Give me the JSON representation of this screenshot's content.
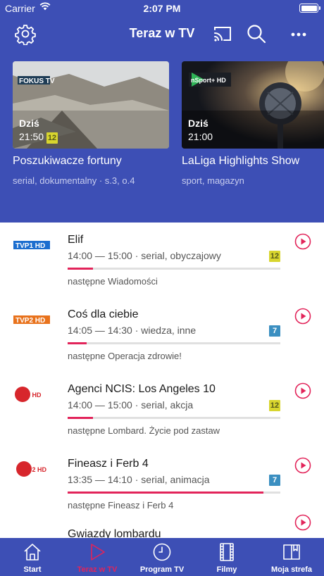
{
  "status_bar": {
    "carrier": "Carrier",
    "time": "2:07 PM"
  },
  "header": {
    "title": "Teraz w TV",
    "icons": [
      "gear-icon",
      "cast-icon",
      "search-icon",
      "more-icon"
    ]
  },
  "featured": [
    {
      "channel_logo": "FOKUS TV",
      "day": "Dziś",
      "time": "21:50",
      "age_rating": "12",
      "title": "Poszukiwacze fortuny",
      "subtitle": "serial, dokumentalny · s.3, o.4"
    },
    {
      "channel_logo": "nSport+ HD",
      "day": "Dziś",
      "time": "21:00",
      "title": "LaLiga Highlights Show",
      "subtitle": "sport, magazyn"
    }
  ],
  "schedule": [
    {
      "channel": "TVP1 HD",
      "title": "Elif",
      "meta": "14:00 — 15:00 · serial, obyczajowy",
      "age_rating": "12",
      "progress": 0.12,
      "next": "następne Wiadomości"
    },
    {
      "channel": "TVP2 HD",
      "title": "Coś dla ciebie",
      "meta": "14:05 — 14:30 · wiedza, inne",
      "age_rating": "7",
      "progress": 0.09,
      "next": "następne Operacja zdrowie!"
    },
    {
      "channel": "Puls HD",
      "title": "Agenci NCIS: Los Angeles 10",
      "meta": "14:00 — 15:00 · serial, akcja",
      "age_rating": "12",
      "progress": 0.12,
      "next": "następne Lombard. Życie pod zastaw"
    },
    {
      "channel": "Puls 2 HD",
      "title": "Fineasz i Ferb 4",
      "meta": "13:35 — 14:10 · serial, animacja",
      "age_rating": "7",
      "progress": 0.92,
      "next": "następne Fineasz i Ferb 4"
    },
    {
      "channel": "",
      "title": "Gwiazdy lombardu",
      "meta": "",
      "progress": 0,
      "next": ""
    }
  ],
  "tabs": [
    {
      "label": "Start",
      "icon": "home-icon",
      "active": false
    },
    {
      "label": "Teraz w TV",
      "icon": "play-outline-icon",
      "active": true
    },
    {
      "label": "Program TV",
      "icon": "clock-icon",
      "active": false
    },
    {
      "label": "Filmy",
      "icon": "film-icon",
      "active": false
    },
    {
      "label": "Moja strefa",
      "icon": "book-icon",
      "active": false
    }
  ],
  "colors": {
    "brand_blue": "#3d4fb5",
    "accent_red": "#e2245a",
    "rating_12": "#d8d52e",
    "rating_7": "#3b8fc1"
  }
}
